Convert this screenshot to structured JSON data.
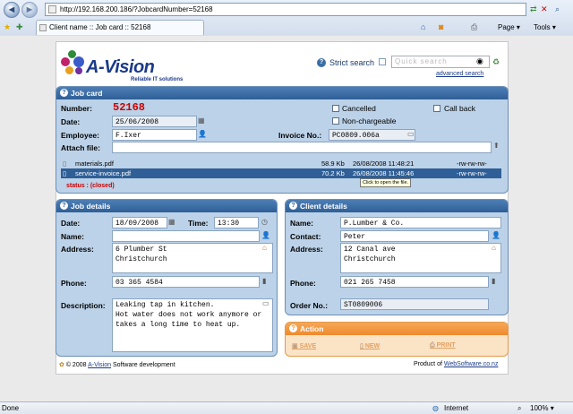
{
  "browser": {
    "url": "http://192.168.200.186/?JobcardNumber=52168",
    "tab_title": "Client name :: Job card :: 52168",
    "commands": {
      "page": "Page",
      "tools": "Tools"
    },
    "status_left": "Done",
    "zone": "Internet",
    "zoom": "100%"
  },
  "header": {
    "logo": "A-Vision",
    "logo_sub": "Reliable IT solutions",
    "strict_search_label": "Strict search",
    "search_placeholder": "Quick search",
    "advanced_search": "advanced search"
  },
  "job_card": {
    "title": "Job card",
    "number_label": "Number:",
    "number": "52168",
    "date_label": "Date:",
    "date": "25/06/2008",
    "employee_label": "Employee:",
    "employee": "F.Ixer",
    "attach_label": "Attach file:",
    "invoice_label": "Invoice No.:",
    "invoice": "PC0809.006a",
    "cancelled_label": "Cancelled",
    "callback_label": "Call back",
    "nonchargeable_label": "Non-chargeable",
    "files": [
      {
        "name": "materials.pdf",
        "size": "58.9 Kb",
        "date": "26/08/2008 11:48:21",
        "perm": "-rw-rw-rw-"
      },
      {
        "name": "service-invoice.pdf",
        "size": "70.2 Kb",
        "date": "26/08/2008 11:45:46",
        "perm": "-rw-rw-rw-"
      }
    ],
    "tooltip": "Click to open the file.",
    "status": "status : (closed)"
  },
  "job_details": {
    "title": "Job details",
    "date_label": "Date:",
    "date": "18/09/2008",
    "time_label": "Time:",
    "time": "13:30",
    "name_label": "Name:",
    "name": "",
    "address_label": "Address:",
    "address": "6 Plumber St\nChristchurch",
    "phone_label": "Phone:",
    "phone": "03 365 4584",
    "description_label": "Description:",
    "description": "Leaking tap in kitchen.\nHot water does not work anymore or\ntakes a long time to heat up."
  },
  "client_details": {
    "title": "Client details",
    "name_label": "Name:",
    "name": "P.Lumber & Co.",
    "contact_label": "Contact:",
    "contact": "Peter",
    "address_label": "Address:",
    "address": "12 Canal ave\nChristchurch",
    "phone_label": "Phone:",
    "phone": "021 265 7458",
    "order_label": "Order No.:",
    "order": "ST0809006"
  },
  "action": {
    "title": "Action",
    "save": "SAVE",
    "new": "NEW",
    "print": "PRINT"
  },
  "footer": {
    "copyright": "© 2008",
    "brand": "A-Vision",
    "suffix": "Software development",
    "product_of": "Product of",
    "website": "WebSoftware.co.nz"
  }
}
